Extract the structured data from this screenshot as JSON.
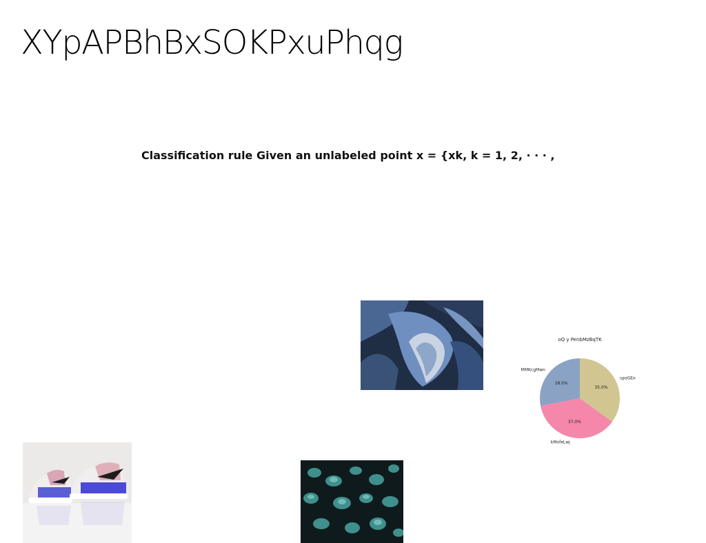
{
  "page": {
    "title": "XYpAPBhBxSOKPxuPhqg",
    "caption": "Classification rule Given an unlabeled point x = {xk, k = 1, 2, · · · ,"
  },
  "images": {
    "abstract_photo": "abstract blue folded shapes",
    "leaves_photo": "teal round leaves on dark background",
    "sneakers_photo": "pair of iridescent sneakers on white floor"
  },
  "colors": {
    "slice_1": "#d1c592",
    "slice_2": "#f587ab",
    "slice_3": "#8aa3c4"
  },
  "chart_data": {
    "type": "pie",
    "title": "oQ y PenbMzBqTK",
    "start_angle_deg": 90,
    "direction": "clockwise",
    "slices": [
      {
        "label": "upsGEo",
        "value": 35.0,
        "pct_label": "35.0%",
        "color": "#d1c592"
      },
      {
        "label": "kMofeLwj",
        "value": 37.0,
        "pct_label": "37.0%",
        "color": "#f587ab"
      },
      {
        "label": "MMKcgMwn",
        "value": 28.0,
        "pct_label": "28.0%",
        "color": "#8aa3c4"
      }
    ]
  }
}
